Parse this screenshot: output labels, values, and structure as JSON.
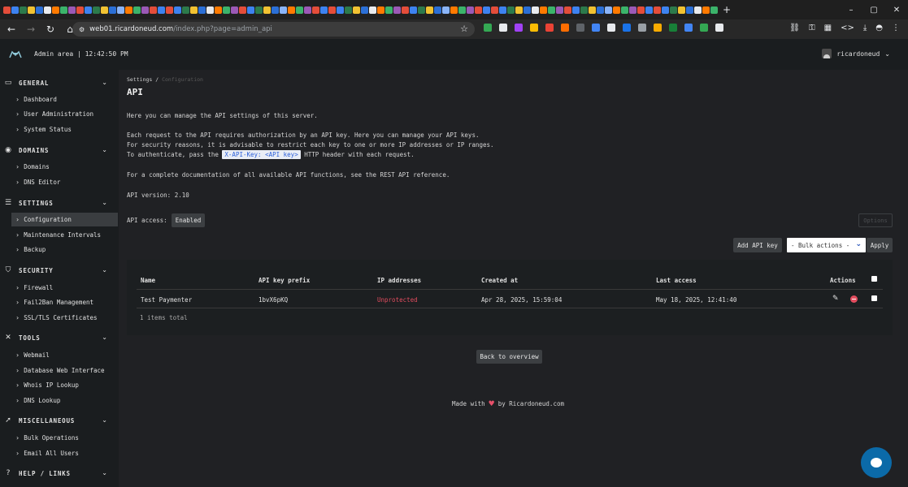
{
  "browser": {
    "url_host": "web01.ricardoneud.com",
    "url_path": "/index.php?page=admin_api",
    "new_tab_label": "+",
    "tab_colors": [
      "#e44d3a",
      "#3d82f0",
      "#2c7a4b",
      "#f1c232",
      "#2b6fd6",
      "#e8eaed",
      "#ff7a00",
      "#3bb36a",
      "#9b59b6",
      "#e44d3a",
      "#3d82f0",
      "#2c7a4b",
      "#f1c232",
      "#2b6fd6",
      "#8ab4f8",
      "#ff7a00",
      "#3bb36a",
      "#9b59b6",
      "#e44d3a",
      "#3d82f0"
    ],
    "extension_colors": [
      "#34a853",
      "#e8eaed",
      "#a142f4",
      "#fbbc04",
      "#ea4335",
      "#ff6d00",
      "#5f6368",
      "#4285f4",
      "#e8eaed",
      "#1a73e8",
      "#9aa0a6",
      "#f9ab00",
      "#188038",
      "#4285f4",
      "#34a853",
      "#e8eaed"
    ]
  },
  "header": {
    "title": "Admin area | 12:42:50 PM",
    "username": "ricardoneud"
  },
  "sidebar": {
    "sections": [
      {
        "label": "GENERAL",
        "icon": "monitor-icon",
        "items": [
          "Dashboard",
          "User Administration",
          "System Status"
        ]
      },
      {
        "label": "DOMAINS",
        "icon": "globe-icon",
        "items": [
          "Domains",
          "DNS Editor"
        ]
      },
      {
        "label": "SETTINGS",
        "icon": "sliders-icon",
        "items": [
          "Configuration",
          "Maintenance Intervals",
          "Backup"
        ]
      },
      {
        "label": "SECURITY",
        "icon": "shield-icon",
        "items": [
          "Firewall",
          "Fail2Ban Management",
          "SSL/TLS Certificates"
        ]
      },
      {
        "label": "TOOLS",
        "icon": "wrench-icon",
        "items": [
          "Webmail",
          "Database Web Interface",
          "Whois IP Lookup",
          "DNS Lookup"
        ]
      },
      {
        "label": "MISCELLANEOUS",
        "icon": "rocket-icon",
        "items": [
          "Bulk Operations",
          "Email All Users"
        ]
      },
      {
        "label": "HELP / LINKS",
        "icon": "help-icon",
        "items": []
      }
    ],
    "active_item": "Configuration"
  },
  "main": {
    "breadcrumb_parent": "Settings",
    "breadcrumb_sep": "/",
    "breadcrumb_current": "Configuration",
    "title": "API",
    "intro": "Here you can manage the API settings of this server.",
    "para1_line1": "Each request to the API requires authorization by an API key. Here you can manage your API keys.",
    "para1_line2": "For security reasons, it is advisable to restrict each key to one or more IP addresses or IP ranges.",
    "para1_line3_pre": "To authenticate, pass the",
    "header_code": "X-API-Key: <API key>",
    "para1_line3_post": "HTTP header with each request.",
    "doc_line": "For a complete documentation of all available API functions, see the REST API reference.",
    "api_version": "API version: 2.10",
    "api_access_label": "API access:",
    "api_access_value": "Enabled",
    "options_label": "Options",
    "add_key_label": "Add API key",
    "bulk_placeholder": "- Bulk actions -",
    "apply_label": "Apply",
    "table": {
      "columns": [
        "Name",
        "API key prefix",
        "IP addresses",
        "Created at",
        "Last access",
        "Actions"
      ],
      "rows": [
        {
          "name": "Test Paymenter",
          "prefix": "1bvX6pKQ",
          "ips": "Unprotected",
          "created": "Apr 28, 2025, 15:59:04",
          "last_access": "May 18, 2025, 12:41:40"
        }
      ],
      "total": "1 items total"
    },
    "back_label": "Back to overview",
    "footer_pre": "Made with",
    "footer_post": "by Ricardoneud.com"
  }
}
